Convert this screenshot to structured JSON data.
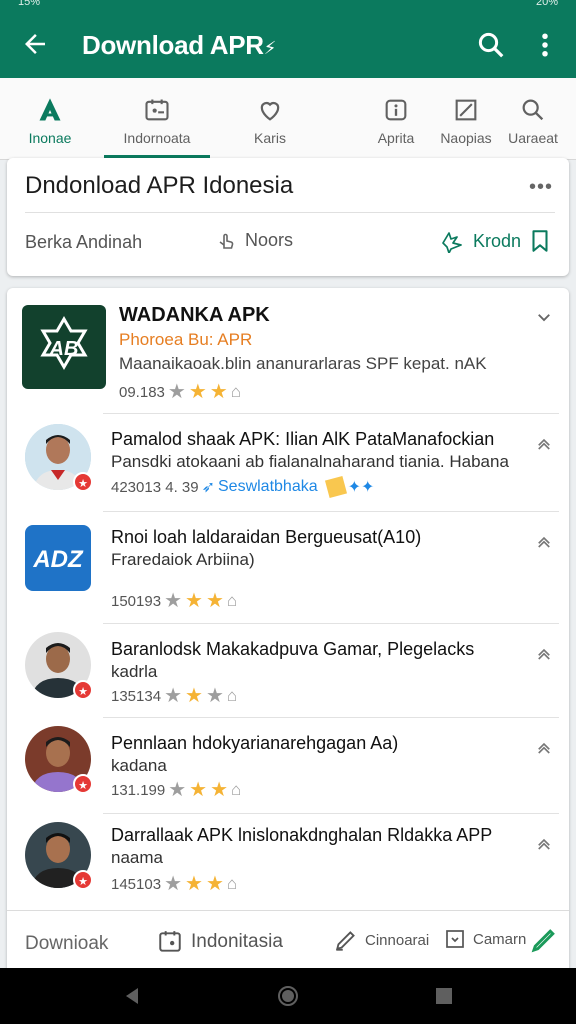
{
  "status_bar": {
    "left": "15%",
    "right": "20%"
  },
  "app_bar": {
    "title": "Download APR",
    "title_suffix": "⚡",
    "accent": "#0b7a5e"
  },
  "tabs": [
    {
      "label": "Inonae",
      "icon": "app-logo-icon",
      "active": true
    },
    {
      "label": "Indornoata",
      "icon": "image-icon",
      "underline": true
    },
    {
      "label": "Karis",
      "icon": "heart-icon"
    },
    {
      "label": "Aprita",
      "icon": "info-icon"
    },
    {
      "label": "Naopias",
      "icon": "edit-box-icon"
    },
    {
      "label": "Uaraeat",
      "icon": "search-icon"
    }
  ],
  "header": {
    "title": "Dndonload APR Idonesia",
    "more": "•••",
    "left_label": "Berka Andinah",
    "mid_label": "Noors",
    "right_label": "Krodn"
  },
  "featured": {
    "name": "WADANKA APK",
    "developer": "Phoroea Bu: APR",
    "description": "Maanaikaoak.blin ananurarlaras SPF kepat. nAK",
    "rating_count": "09.183",
    "stars": 2
  },
  "items": [
    {
      "title": "Pamalod shaak APK: Ilian AlK PataManafockian",
      "subtitle": "Pansdki atokaani ab fialanalnaharand tiania. Habana",
      "rating_count": "423013 4. 39",
      "tag": "Seswlatbhaka",
      "stars": 0,
      "badge": "★"
    },
    {
      "title": "Rnoi loah laldaraidan Bergueusat(A10)",
      "subtitle": "Fraredaiok Arbiina)",
      "rating_count": "150193",
      "stars": 2
    },
    {
      "title": "Baranlodsk Makakadpuva Gamar, Plegelacks",
      "subtitle": "kadrla",
      "rating_count": "135134",
      "stars": 1,
      "badge": "★"
    },
    {
      "title": "Pennlaan hdokyarianarehgagan Aa)",
      "subtitle": "kadana",
      "rating_count": "131.199",
      "stars": 2,
      "badge": "★"
    },
    {
      "title": "Darrallaak APK lnislonakdnghalan Rldakka APP",
      "subtitle": "naama",
      "rating_count": "145103",
      "stars": 2,
      "badge": "★"
    }
  ],
  "footer": {
    "download": "Downioak",
    "indonesia": "Indonitasia",
    "cinnoarai": "Cinnoarai",
    "camarn": "Camarn"
  }
}
